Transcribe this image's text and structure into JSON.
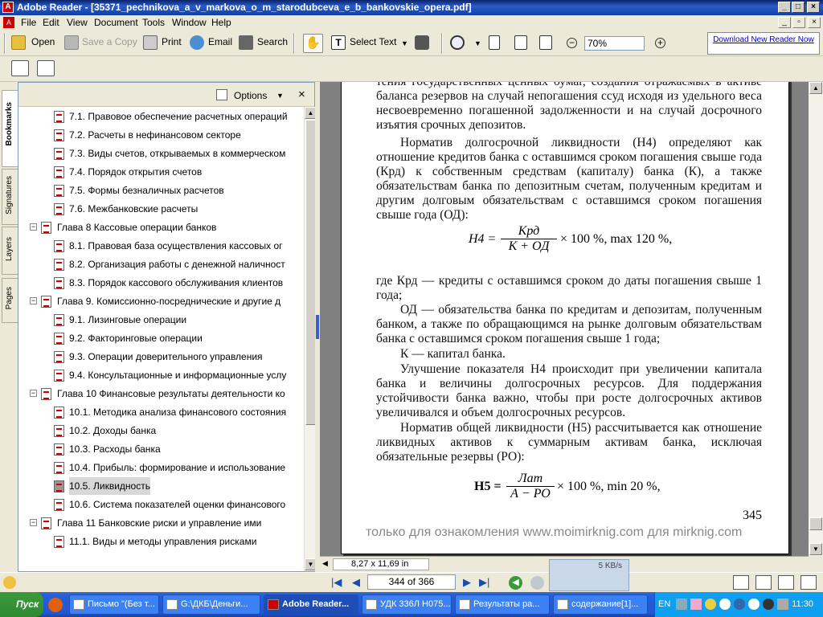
{
  "window": {
    "title": "Adobe Reader - [35371_pechnikova_a_v_markova_o_m_starodubceva_e_b_bankovskie_opera.pdf]"
  },
  "menu": [
    "File",
    "Edit",
    "View",
    "Document",
    "Tools",
    "Window",
    "Help"
  ],
  "toolbar": {
    "open": "Open",
    "save_copy": "Save a Copy",
    "print": "Print",
    "email": "Email",
    "search": "Search",
    "select_text": "Select Text",
    "zoom": "70%",
    "download": "Download New Reader Now"
  },
  "bookmarks": {
    "options": "Options",
    "items": [
      {
        "label": "7.1. Правовое обеспечение расчетных операций",
        "level": 2
      },
      {
        "label": "7.2. Расчеты в нефинансовом секторе",
        "level": 2
      },
      {
        "label": "7.3. Виды счетов, открываемых в коммерческом",
        "level": 2
      },
      {
        "label": "7.4. Порядок открытия счетов",
        "level": 2
      },
      {
        "label": "7.5. Формы безналичных расчетов",
        "level": 2
      },
      {
        "label": "7.6. Межбанковские расчеты",
        "level": 2
      },
      {
        "label": "Глава 8 Кассовые операции банков",
        "level": 1
      },
      {
        "label": "8.1. Правовая база осуществления кассовых ог",
        "level": 2
      },
      {
        "label": "8.2. Организация работы с денежной наличност",
        "level": 2
      },
      {
        "label": "8.3. Порядок кассового обслуживания клиентов",
        "level": 2
      },
      {
        "label": "Глава 9. Комиссионно-посреднические и другие д",
        "level": 1
      },
      {
        "label": "9.1. Лизинговые операции",
        "level": 2
      },
      {
        "label": "9.2. Факторинговые операции",
        "level": 2
      },
      {
        "label": "9.3. Операции доверительного управления",
        "level": 2
      },
      {
        "label": "9.4. Консультационные и информационные услу",
        "level": 2
      },
      {
        "label": "Глава 10 Финансовые результаты деятельности ко",
        "level": 1
      },
      {
        "label": "10.1. Методика анализа финансового состояния",
        "level": 2
      },
      {
        "label": "10.2. Доходы банка",
        "level": 2
      },
      {
        "label": "10.3. Расходы банка",
        "level": 2
      },
      {
        "label": "10.4. Прибыль: формирование и использование",
        "level": 2
      },
      {
        "label": "10.5. Ликвидность",
        "level": 2,
        "selected": true
      },
      {
        "label": "10.6. Система показателей оценки финансового",
        "level": 2
      },
      {
        "label": "Глава 11 Банковские риски и управление ими",
        "level": 1
      },
      {
        "label": "11.1. Виды и методы управления рисками",
        "level": 2
      }
    ]
  },
  "tabs": [
    "Bookmarks",
    "Signatures",
    "Layers",
    "Pages"
  ],
  "document": {
    "p1": "тения государственных ценных бумаг, создания отражаемых в активе баланса резервов на случай непогашения ссуд исходя из удельного веса несвоевременно погашенной задолженности и на случай досрочного изъятия срочных депозитов.",
    "p2": "Норматив долгосрочной ликвидности (Н4) определяют как отношение кредитов банка с оставшимся сроком погашения свыше года (Крд) к собственным средствам (капиталу) банка (К), а также обязательствам банка по депозитным счетам, полученным кредитам и другим долговым обязательствам с оставшимся сроком погашения свыше года (ОД):",
    "f1_left": "H4 =",
    "f1_num": "Крд",
    "f1_den": "К + ОД",
    "f1_right": "× 100 %, max 120 %,",
    "p3": "где  Крд — кредиты с оставшимся сроком до даты погашения свыше 1 года;",
    "p4": "ОД — обязательства банка по кредитам и депозитам, полученным банком, а также по обращающимся на рынке долговым обязательствам банка с оставшимся сроком погашения свыше 1 года;",
    "p5": "К — капитал банка.",
    "p6": "Улучшение показателя Н4 происходит при увеличении капитала банка и величины долгосрочных ресурсов. Для поддержания устойчивости банка важно, чтобы при росте долгосрочных активов увеличивался и объем долгосрочных ресурсов.",
    "p7": "Норматив общей ликвидности (Н5) рассчитывается как отношение ликвидных активов к суммарным активам банка, исключая обязательные резервы (РО):",
    "f2_left": "H5 =",
    "f2_num": "Лат",
    "f2_den": "А − РО",
    "f2_right": "× 100 %, min 20 %,",
    "page_number": "345",
    "watermark": "только для ознакомления www.moimirknig.com для mirknig.com"
  },
  "status": {
    "page_size": "8,27 x 11,69 in",
    "page": "344 of 366",
    "speed": "5 KB/s"
  },
  "taskbar": {
    "start": "Пуск",
    "tasks": [
      "Письмо \"(Без т...",
      "G:\\ДКБ\\Деньги...",
      "Adobe Reader...",
      "УДК 336Л Н075...",
      "Результаты ра...",
      "содержание[1]..."
    ],
    "lang": "EN",
    "clock": "11:30"
  }
}
